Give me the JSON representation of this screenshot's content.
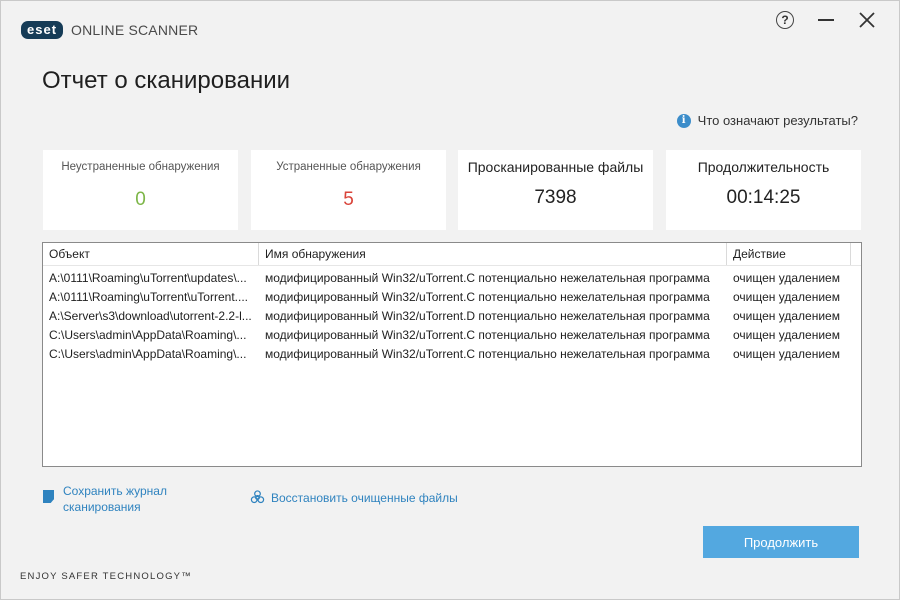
{
  "app": {
    "logo_text": "eset",
    "product_name": "ONLINE SCANNER",
    "help_symbol": "?",
    "title": "Отчет о сканировании",
    "results_link": "Что означают результаты?",
    "info_symbol": "i"
  },
  "stats": [
    {
      "label": "Неустраненные обнаружения",
      "value": "0",
      "color": "#7db648"
    },
    {
      "label": "Устраненные обнаружения",
      "value": "5",
      "color": "#d9443a"
    },
    {
      "label": "Просканированные файлы",
      "value": "7398"
    },
    {
      "label": "Продолжительность",
      "value": "00:14:25"
    }
  ],
  "table": {
    "headers": [
      "Объект",
      "Имя обнаружения",
      "Действие"
    ],
    "rows": [
      [
        "A:\\0111\\Roaming\\uTorrent\\updates\\...",
        "модифицированный Win32/uTorrent.C потенциально нежелательная программа",
        "очищен удалением"
      ],
      [
        "A:\\0111\\Roaming\\uTorrent\\uTorrent....",
        "модифицированный Win32/uTorrent.C потенциально нежелательная программа",
        "очищен удалением"
      ],
      [
        "A:\\Server\\s3\\download\\utorrent-2.2-l...",
        "модифицированный Win32/uTorrent.D потенциально нежелательная программа",
        "очищен удалением"
      ],
      [
        "C:\\Users\\admin\\AppData\\Roaming\\...",
        "модифицированный Win32/uTorrent.C потенциально нежелательная программа",
        "очищен удалением"
      ],
      [
        "C:\\Users\\admin\\AppData\\Roaming\\...",
        "модифицированный Win32/uTorrent.C потенциально нежелательная программа",
        "очищен удалением"
      ]
    ]
  },
  "actions": {
    "save_log_line1": "Сохранить журнал",
    "save_log_line2": "сканирования",
    "restore": "Восстановить очищенные файлы",
    "continue": "Продолжить"
  },
  "footer": {
    "tagline": "ENJOY SAFER TECHNOLOGY™"
  },
  "colors": {
    "accent": "#53a8e0",
    "link": "#2f83bf",
    "brand": "#163c57"
  }
}
